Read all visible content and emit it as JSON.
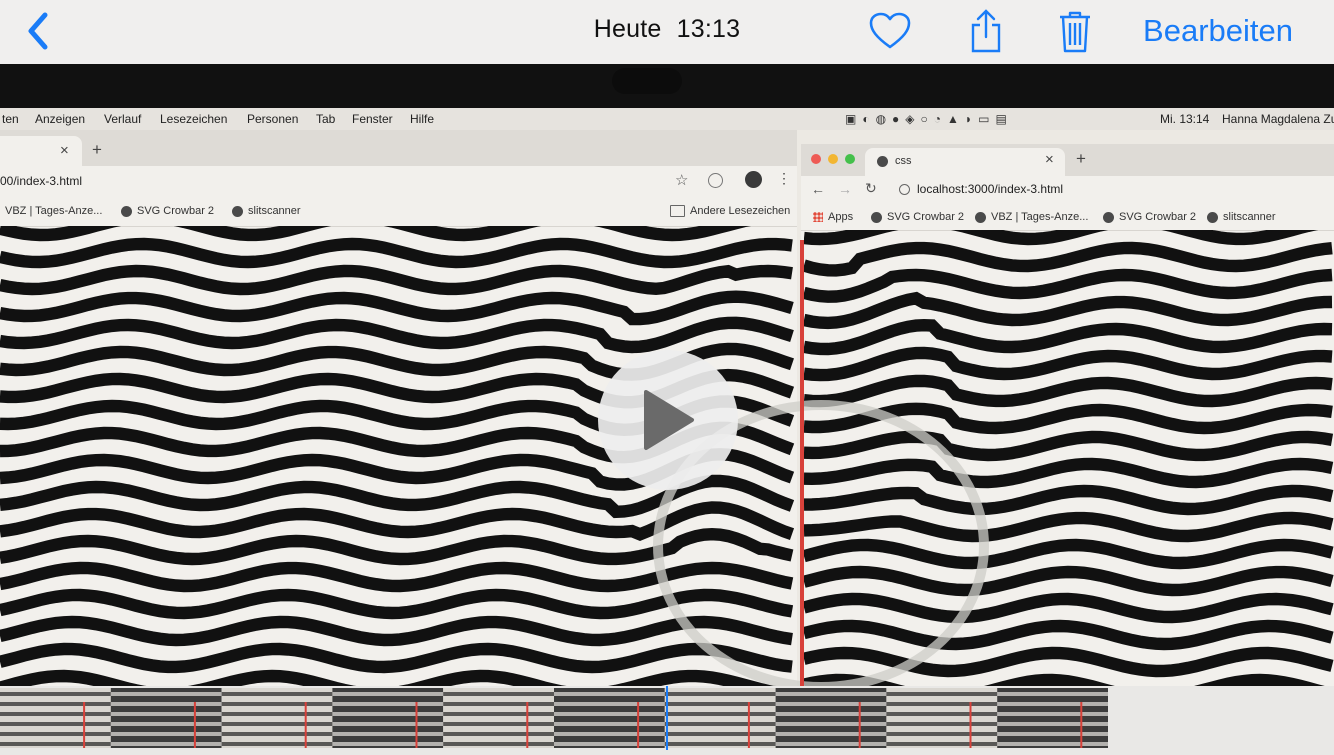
{
  "header": {
    "title_day": "Heute",
    "title_time": "13:13",
    "edit_label": "Bearbeiten"
  },
  "colors": {
    "accent": "#1a7cf7",
    "red_line": "#d8413a"
  },
  "icons": {
    "back": "chevron-left-icon",
    "favorite": "heart-icon",
    "share": "share-icon",
    "delete": "trash-icon",
    "play": "play-icon"
  },
  "screen": {
    "menubar": {
      "items": [
        "ten",
        "Anzeigen",
        "Verlauf",
        "Lesezeichen",
        "Personen",
        "Tab",
        "Fenster",
        "Hilfe"
      ],
      "clock": "Mi. 13:14",
      "user": "Hanna Magdalena Zu"
    },
    "left_browser": {
      "url": "00/index-3.html",
      "bookmarks": [
        "VBZ | Tages-Anze...",
        "SVG Crowbar 2",
        "slitscanner"
      ],
      "other_bookmarks": "Andere Lesezeichen",
      "tab_close": "×",
      "new_tab": "+"
    },
    "right_browser": {
      "tab_title": "css",
      "url": "localhost:3000/index-3.html",
      "bookmarks": [
        "Apps",
        "SVG Crowbar 2",
        "VBZ | Tages-Anze...",
        "SVG Crowbar 2",
        "slitscanner"
      ],
      "tab_close": "×",
      "new_tab": "+"
    }
  },
  "timeline": {
    "frame_count": 10,
    "playhead_fraction": 0.5
  }
}
